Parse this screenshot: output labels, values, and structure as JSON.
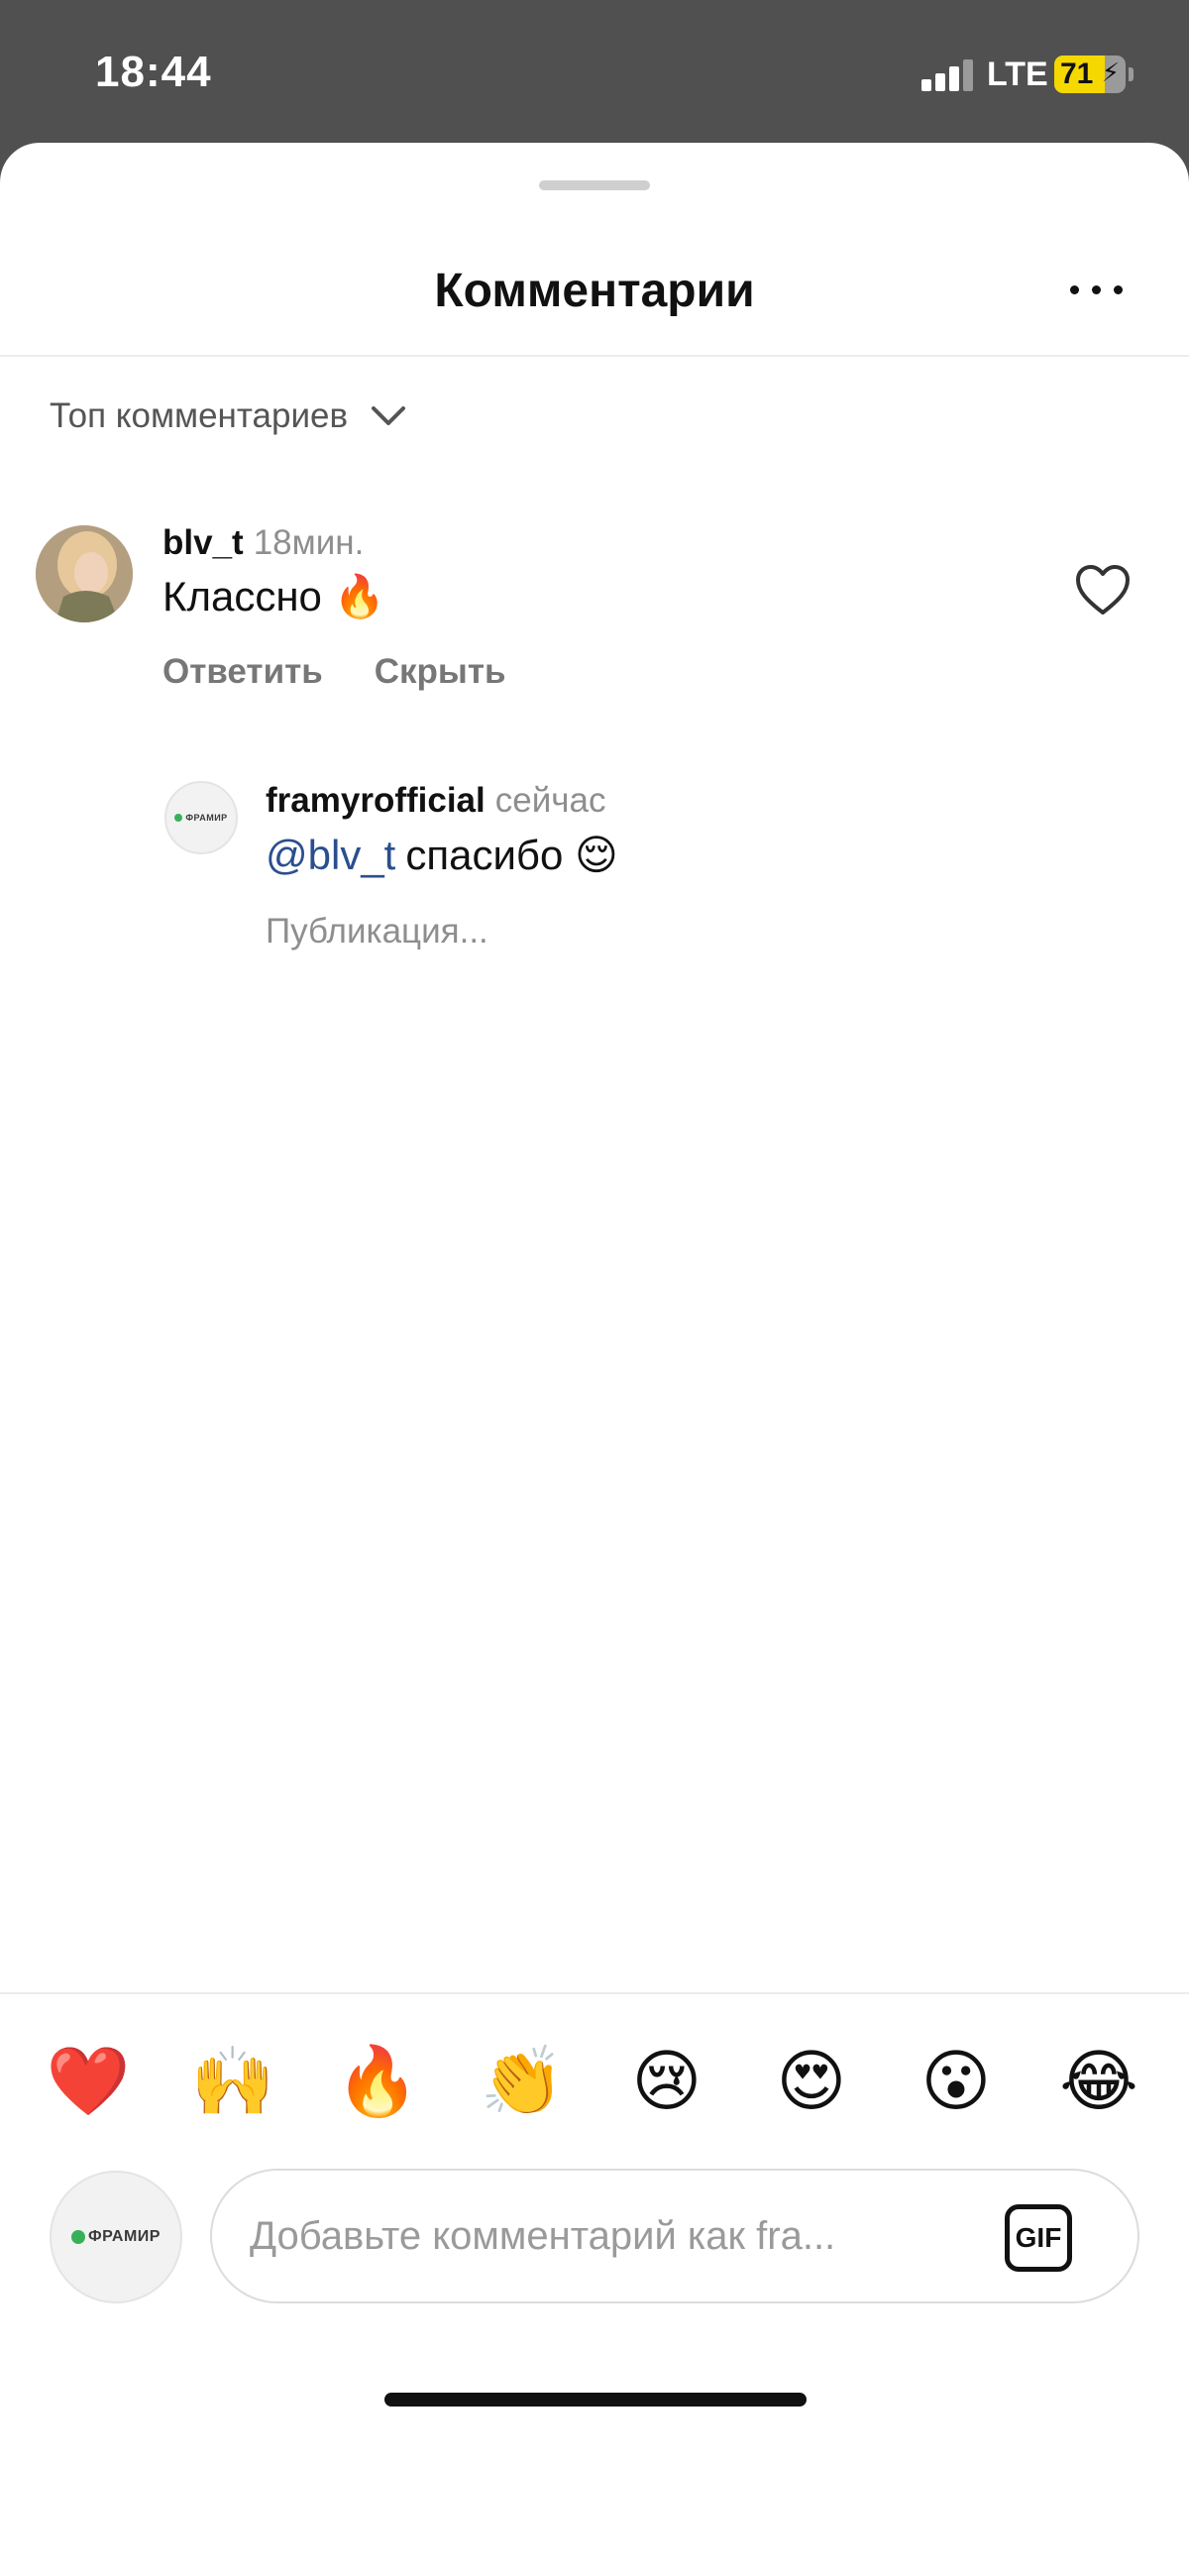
{
  "status_bar": {
    "time": "18:44",
    "network": "LTE",
    "battery_percent": 71,
    "battery_label": "71",
    "charging": true,
    "signal_bars_active": 3,
    "signal_bars_total": 4
  },
  "header": {
    "title": "Комментарии",
    "more_icon": "more-horizontal-icon"
  },
  "sort": {
    "label": "Топ комментариев",
    "icon": "chevron-down-icon"
  },
  "comments": [
    {
      "username": "blv_t",
      "time": "18мин.",
      "text": "Классно 🔥",
      "actions": {
        "reply": "Ответить",
        "hide": "Скрыть"
      },
      "like_icon": "heart-outline-icon",
      "replies": [
        {
          "username": "framyrofficial",
          "time": "сейчас",
          "mention": "@blv_t",
          "text": "спасибо 😌",
          "status": "Публикация...",
          "avatar_logo_text": "ФРАМИР"
        }
      ]
    }
  ],
  "quick_reactions": [
    "❤️",
    "🙌",
    "🔥",
    "👏",
    "😢",
    "😍",
    "😮",
    "😂"
  ],
  "composer": {
    "avatar_logo_text": "ФРАМИР",
    "placeholder": "Добавьте комментарий как fra...",
    "gif_label": "GIF"
  },
  "colors": {
    "status_bar_bg": "#505050",
    "battery_fill": "#f5d800",
    "mention": "#2a4f8f",
    "logo_green": "#38b05a"
  }
}
